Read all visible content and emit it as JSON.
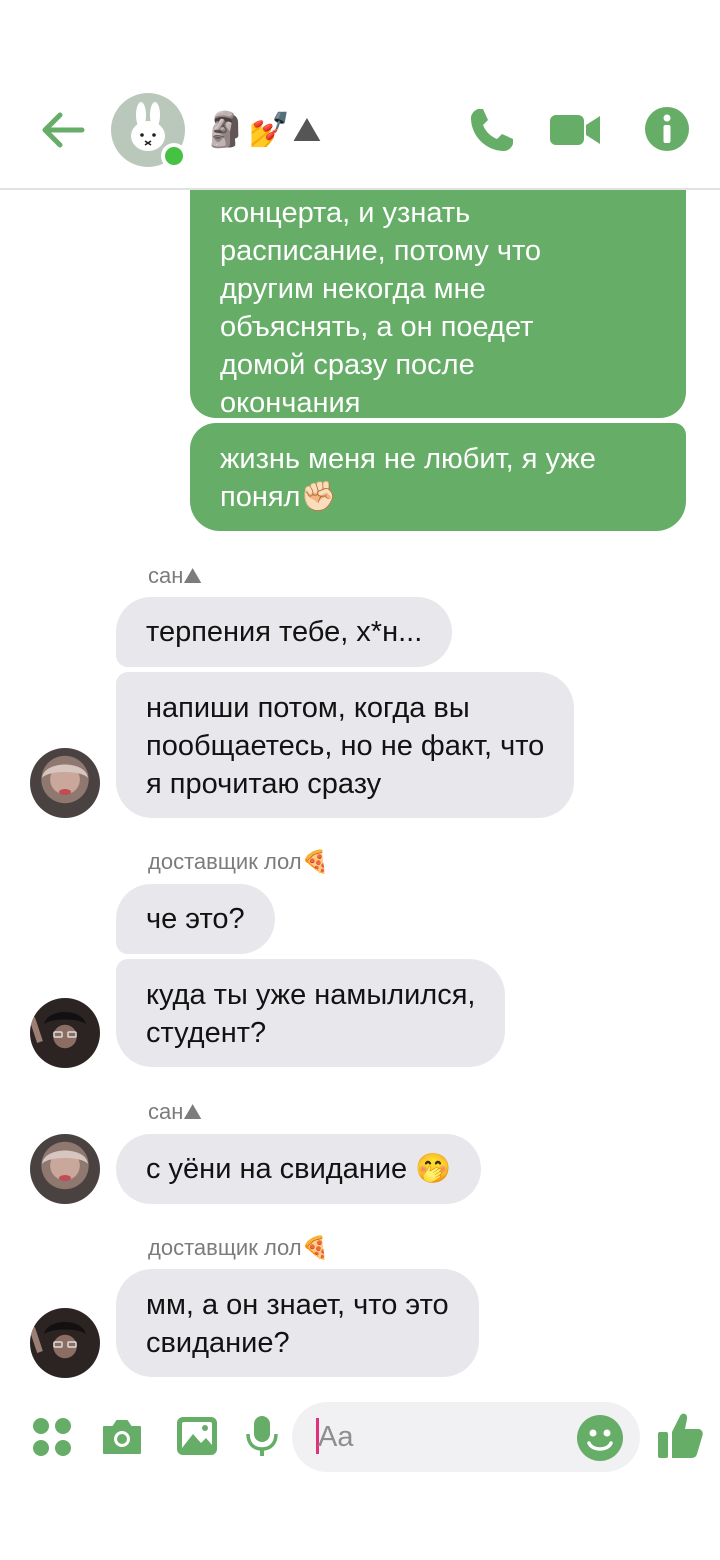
{
  "header": {
    "back_icon": "arrow-left-icon",
    "chat_title": "🗿💅⛰",
    "avatar_icon": "miffy-bunny-avatar",
    "online": true,
    "call_icon": "phone-icon",
    "video_icon": "video-camera-icon",
    "info_icon": "info-icon",
    "accent_color": "#66ad68"
  },
  "messages": {
    "out_1": {
      "lines": [
        "концерта, и узнать",
        "расписание, потому что",
        "другим некогда мне",
        "объяснять, а он поедет",
        "домой сразу после",
        "окончания"
      ]
    },
    "out_2": {
      "lines": [
        "жизнь меня не любит, я уже",
        "понял✊🏻"
      ]
    },
    "sender_1": "сан⛰",
    "in_1": "терпения тебе, х*н...",
    "in_2": {
      "lines": [
        "напиши потом, когда вы",
        "пообщаетесь, но не факт, что",
        "я прочитаю сразу"
      ]
    },
    "sender_2": "доставщик лол🍕",
    "in_3": "че это?",
    "in_4": {
      "lines": [
        "куда ты уже намылился,",
        "студент?"
      ]
    },
    "sender_3": "сан⛰",
    "in_5": "с уёни на свидание 🤭",
    "sender_4": "доставщик лол🍕",
    "in_6": {
      "lines": [
        "мм, а он знает, что это",
        "свидание?"
      ]
    }
  },
  "composer": {
    "menu_icon": "four-dots-icon",
    "camera_icon": "camera-icon",
    "gallery_icon": "image-icon",
    "mic_icon": "microphone-icon",
    "placeholder": "Aa",
    "emoji_icon": "smiley-icon",
    "like_icon": "thumbs-up-icon"
  }
}
